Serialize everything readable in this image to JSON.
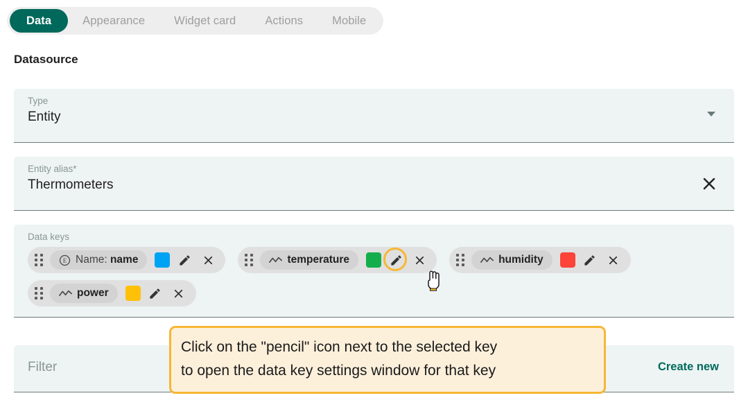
{
  "tabs": [
    {
      "label": "Data",
      "active": true
    },
    {
      "label": "Appearance",
      "active": false
    },
    {
      "label": "Widget card",
      "active": false
    },
    {
      "label": "Actions",
      "active": false
    },
    {
      "label": "Mobile",
      "active": false
    }
  ],
  "section": {
    "title": "Datasource"
  },
  "type_field": {
    "label": "Type",
    "value": "Entity"
  },
  "alias_field": {
    "label": "Entity alias*",
    "value": "Thermometers"
  },
  "data_keys": {
    "label": "Data keys",
    "chips": [
      {
        "icon": "circled-e-icon",
        "prefix": "Name:",
        "name": "name",
        "color": "#00a2f3",
        "highlighted": false
      },
      {
        "icon": "timeseries-icon",
        "prefix": "",
        "name": "temperature",
        "color": "#13ae4b",
        "highlighted": true
      },
      {
        "icon": "timeseries-icon",
        "prefix": "",
        "name": "humidity",
        "color": "#fc4438",
        "highlighted": false
      },
      {
        "icon": "timeseries-icon",
        "prefix": "",
        "name": "power",
        "color": "#ffc107",
        "highlighted": false
      }
    ]
  },
  "filter_field": {
    "placeholder": "Filter",
    "create_new_label": "Create new"
  },
  "callout": {
    "line1": "Click on the \"pencil\" icon next to the selected key",
    "line2": "to open the data key settings window for that key",
    "background": "#fdf0db",
    "border": "#f7b733"
  },
  "colors": {
    "accent": "#00695c",
    "panel_bg": "#edf4f3",
    "highlight_ring": "#f7b733"
  }
}
